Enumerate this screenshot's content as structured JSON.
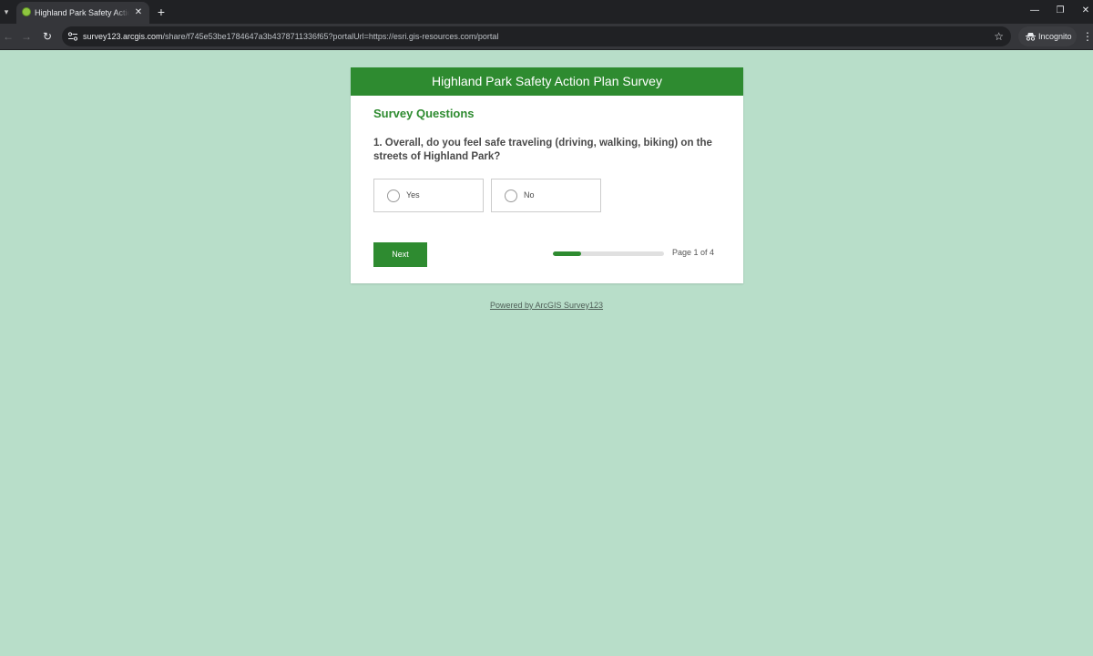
{
  "browser": {
    "tab": {
      "title": "Highland Park Safety Action Plan Survey"
    },
    "address_bar": {
      "host": "survey123.arcgis.com",
      "path": "/share/f745e53be1784647a3b4378711336f65?portalUrl=https://esri.gis-resources.com/portal"
    },
    "incognito_label": "Incognito",
    "icons": {
      "tab_list": "▾",
      "tab_close": "✕",
      "new_tab": "+",
      "minimize": "—",
      "restore": "❐",
      "close": "✕",
      "back": "←",
      "forward": "→",
      "reload": "↻",
      "bookmark": "☆",
      "menu": "⋮"
    }
  },
  "survey": {
    "title": "Highland Park Safety Action Plan Survey",
    "section_title": "Survey Questions",
    "question": "1. Overall, do you feel safe traveling (driving, walking, biking) on the streets of Highland Park?",
    "choices": [
      {
        "label": "Yes",
        "selected": false
      },
      {
        "label": "No",
        "selected": false
      }
    ],
    "next_label": "Next",
    "progress": {
      "current_page": 1,
      "total_pages": 4,
      "fraction": 0.25
    },
    "page_indicator": "Page 1 of 4",
    "accent_color": "#2e8b30"
  },
  "footer": {
    "powered_by": "Powered by ArcGIS Survey123"
  }
}
